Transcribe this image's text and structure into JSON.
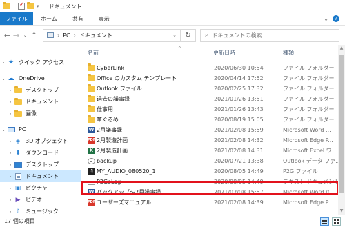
{
  "window": {
    "title": "ドキュメント"
  },
  "ribbon": {
    "tabs": [
      "ファイル",
      "ホーム",
      "共有",
      "表示"
    ],
    "expand_icon": "chevron-down-icon",
    "help_icon": "help-icon"
  },
  "nav": {
    "path": [
      "PC",
      "ドキュメント"
    ],
    "search_placeholder": "ドキュメントの検索"
  },
  "sidebar": {
    "items": [
      {
        "label": "クイック アクセス",
        "icon": "star-icon",
        "arrow": ">"
      },
      {
        "label": "OneDrive",
        "icon": "cloud-icon",
        "arrow": "v"
      },
      {
        "label": "デスクトップ",
        "icon": "folder-icon",
        "arrow": ">"
      },
      {
        "label": "ドキュメント",
        "icon": "folder-icon",
        "arrow": ">"
      },
      {
        "label": "画像",
        "icon": "folder-icon",
        "arrow": ">"
      },
      {
        "label": "PC",
        "icon": "pc-icon",
        "arrow": "v"
      },
      {
        "label": "3D オブジェクト",
        "icon": "cube-icon",
        "arrow": ">"
      },
      {
        "label": "ダウンロード",
        "icon": "download-icon",
        "arrow": ">"
      },
      {
        "label": "デスクトップ",
        "icon": "desktop-icon",
        "arrow": ">"
      },
      {
        "label": "ドキュメント",
        "icon": "document-icon",
        "arrow": ">"
      },
      {
        "label": "ピクチャ",
        "icon": "picture-icon",
        "arrow": ">"
      },
      {
        "label": "ビデオ",
        "icon": "video-icon",
        "arrow": ">"
      },
      {
        "label": "ミュージック",
        "icon": "music-icon",
        "arrow": ">"
      }
    ],
    "selected_index": 9
  },
  "columns": {
    "name": "名前",
    "date": "更新日時",
    "type": "種類"
  },
  "files": [
    {
      "name": "CyberLink",
      "date": "2020/06/30 10:54",
      "type": "ファイル フォルダー",
      "icon": "folder"
    },
    {
      "name": "Office のカスタム テンプレート",
      "date": "2020/04/14 17:52",
      "type": "ファイル フォルダー",
      "icon": "folder"
    },
    {
      "name": "Outlook ファイル",
      "date": "2020/02/25 17:32",
      "type": "ファイル フォルダー",
      "icon": "folder"
    },
    {
      "name": "過去の議事録",
      "date": "2021/01/26 13:51",
      "type": "ファイル フォルダー",
      "icon": "folder"
    },
    {
      "name": "仕事用",
      "date": "2021/01/26 13:43",
      "type": "ファイル フォルダー",
      "icon": "folder"
    },
    {
      "name": "筆ぐるめ",
      "date": "2020/08/19 15:05",
      "type": "ファイル フォルダー",
      "icon": "folder"
    },
    {
      "name": "2月議事録",
      "date": "2021/02/08 15:59",
      "type": "Microsoft Word ...",
      "icon": "word"
    },
    {
      "name": "2月製造計画",
      "date": "2021/02/08 14:32",
      "type": "Microsoft Edge P...",
      "icon": "pdf"
    },
    {
      "name": "2月製造計画",
      "date": "2021/02/08 14:31",
      "type": "Microsoft Excel ワ...",
      "icon": "excel"
    },
    {
      "name": "backup",
      "date": "2020/07/21 13:38",
      "type": "Outlook データ ファ...",
      "icon": "cd"
    },
    {
      "name": "MY_AUDIO_080520_1",
      "date": "2020/08/05 14:49",
      "type": "P2G ファイル",
      "icon": "audio"
    },
    {
      "name": "P2GoLog",
      "date": "2020/08/05 14:49",
      "type": "テキスト ドキュメント",
      "icon": "text"
    },
    {
      "name": "バックアップ～2月議事録",
      "date": "2021/02/08 15:57",
      "type": "Microsoft Word /(...",
      "icon": "word"
    },
    {
      "name": "ユーザーズマニュアル",
      "date": "2021/02/08 14:39",
      "type": "Microsoft Edge P...",
      "icon": "pdf"
    }
  ],
  "status": {
    "count": "17 個の項目"
  },
  "colors": {
    "accent": "#1979ca",
    "selection": "#cce8ff",
    "highlight_border": "#e2121c"
  }
}
